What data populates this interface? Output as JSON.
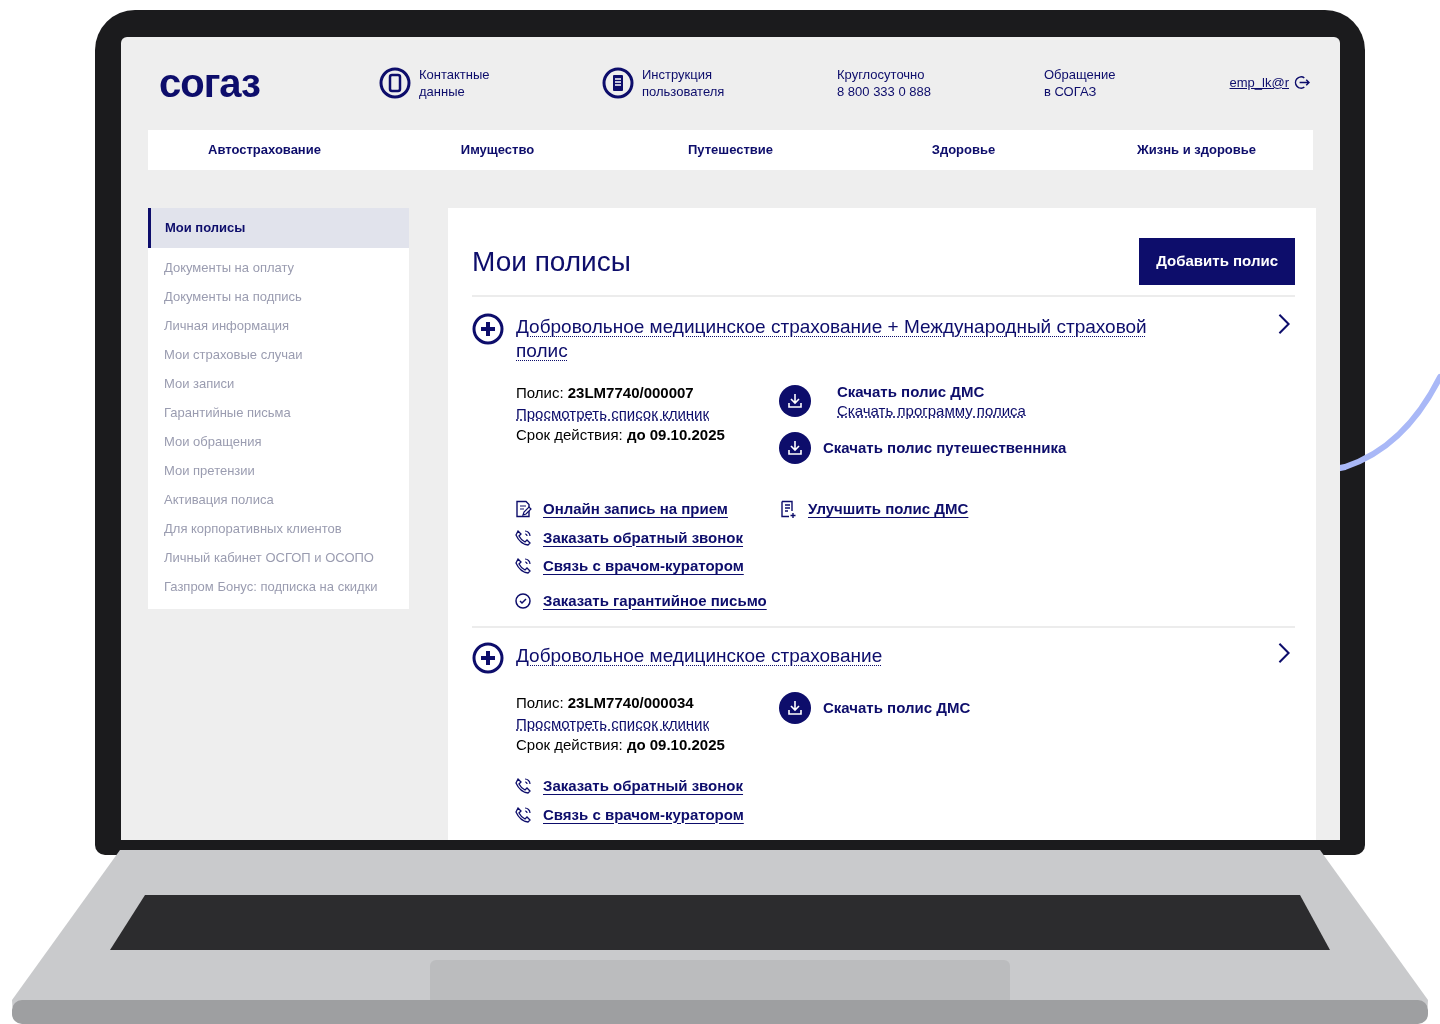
{
  "header": {
    "logo": "согаз",
    "links": [
      {
        "kind": "phone",
        "lines": [
          "Контактные",
          "данные"
        ]
      },
      {
        "kind": "manual",
        "lines": [
          "Инструкция",
          "пользователя"
        ]
      },
      {
        "kind": "text",
        "lines": [
          "Круглосуточно",
          "8 800 333 0 888"
        ]
      },
      {
        "kind": "text",
        "lines": [
          "Обращение",
          "в СОГАЗ"
        ]
      }
    ],
    "user": "emp_lk@r"
  },
  "nav": [
    "Автострахование",
    "Имущество",
    "Путешествие",
    "Здоровье",
    "Жизнь и здоровье"
  ],
  "sidebar": {
    "items": [
      {
        "label": "Мои полисы",
        "selected": true
      },
      {
        "label": "Документы на оплату",
        "selected": false
      },
      {
        "label": "Документы на подпись",
        "selected": false
      },
      {
        "label": "Личная информация",
        "selected": false
      },
      {
        "label": "Мои страховые случаи",
        "selected": false
      },
      {
        "label": "Мои записи",
        "selected": false
      },
      {
        "label": "Гарантийные письма",
        "selected": false
      },
      {
        "label": "Мои обращения",
        "selected": false
      },
      {
        "label": "Мои претензии",
        "selected": false
      },
      {
        "label": "Активация полиса",
        "selected": false
      },
      {
        "label": "Для корпоративных клиентов",
        "selected": false
      },
      {
        "label": "Личный кабинет ОСГОП и ОСОПО",
        "selected": false
      },
      {
        "label": "Газпром Бонус: подписка на скидки",
        "selected": false
      }
    ]
  },
  "main": {
    "title": "Мои полисы",
    "add_button": "Добавить полис",
    "policies": [
      {
        "title": "Добровольное медицинское страхование + Международный страховой полис",
        "number_label": "Полис:",
        "number": "23LM7740/000007",
        "clinics_link": "Просмотреть список клиник",
        "term_label": "Срок действия:",
        "term": "до 09.10.2025",
        "downloads": [
          {
            "label": "Скачать полис ДМС",
            "sublink": "Скачать программу полиса"
          },
          {
            "label": "Скачать полис путешественника"
          }
        ],
        "actions": [
          [
            {
              "kind": "edit",
              "label": "Онлайн запись на прием"
            },
            {
              "kind": "phone",
              "label": "Заказать обратный звонок"
            },
            {
              "kind": "phone",
              "label": "Связь с врачом-куратором"
            },
            {
              "kind": "check",
              "label": "Заказать гарантийное письмо"
            }
          ],
          [
            {
              "kind": "doc-plus",
              "label": "Улучшить полис ДМС"
            }
          ]
        ]
      },
      {
        "title": "Добровольное медицинское страхование",
        "number_label": "Полис:",
        "number": "23LM7740/000034",
        "clinics_link": "Просмотреть список клиник",
        "term_label": "Срок действия:",
        "term": "до 09.10.2025",
        "downloads": [
          {
            "label": "Скачать полис ДМС"
          }
        ],
        "actions": [
          [
            {
              "kind": "phone",
              "label": "Заказать обратный звонок"
            },
            {
              "kind": "phone",
              "label": "Связь с врачом-куратором"
            }
          ]
        ]
      }
    ]
  }
}
